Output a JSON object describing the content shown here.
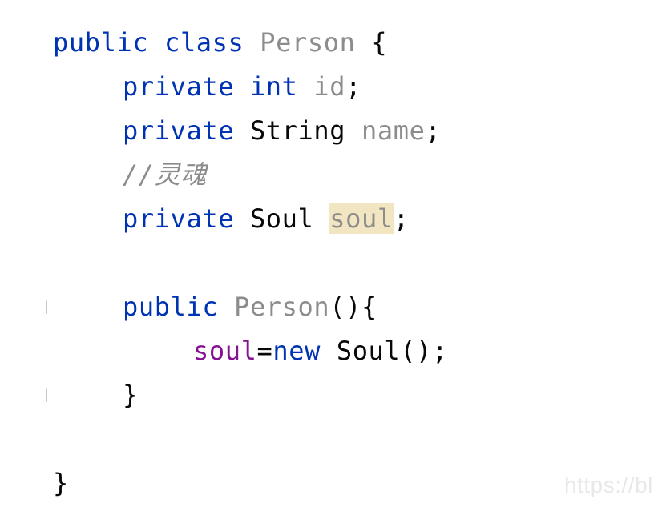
{
  "code": {
    "l1": {
      "kw1": "public",
      "kw2": "class",
      "name": "Person",
      "brace": "{"
    },
    "l2": {
      "kw1": "private",
      "type": "int",
      "name": "id",
      "semi": ";"
    },
    "l3": {
      "kw1": "private",
      "type": "String",
      "name": "name",
      "semi": ";"
    },
    "l4": {
      "comment": "//灵魂"
    },
    "l5": {
      "kw1": "private",
      "type": "Soul",
      "name": "soul",
      "semi": ";"
    },
    "l6": {
      "kw1": "public",
      "name": "Person",
      "rest": "(){"
    },
    "l7": {
      "field": "soul",
      "eq": "=",
      "kw": "new",
      "ctor": "Soul",
      "rest": "();"
    },
    "l8": {
      "brace": "}"
    },
    "l9": {
      "brace": "}"
    }
  },
  "watermark": {
    "text": "https://bl"
  },
  "colors": {
    "keyword": "#0033b3",
    "plain": "#080808",
    "unused": "#8c8c8c",
    "field": "#871094",
    "highlight": "#f2e6c2"
  }
}
